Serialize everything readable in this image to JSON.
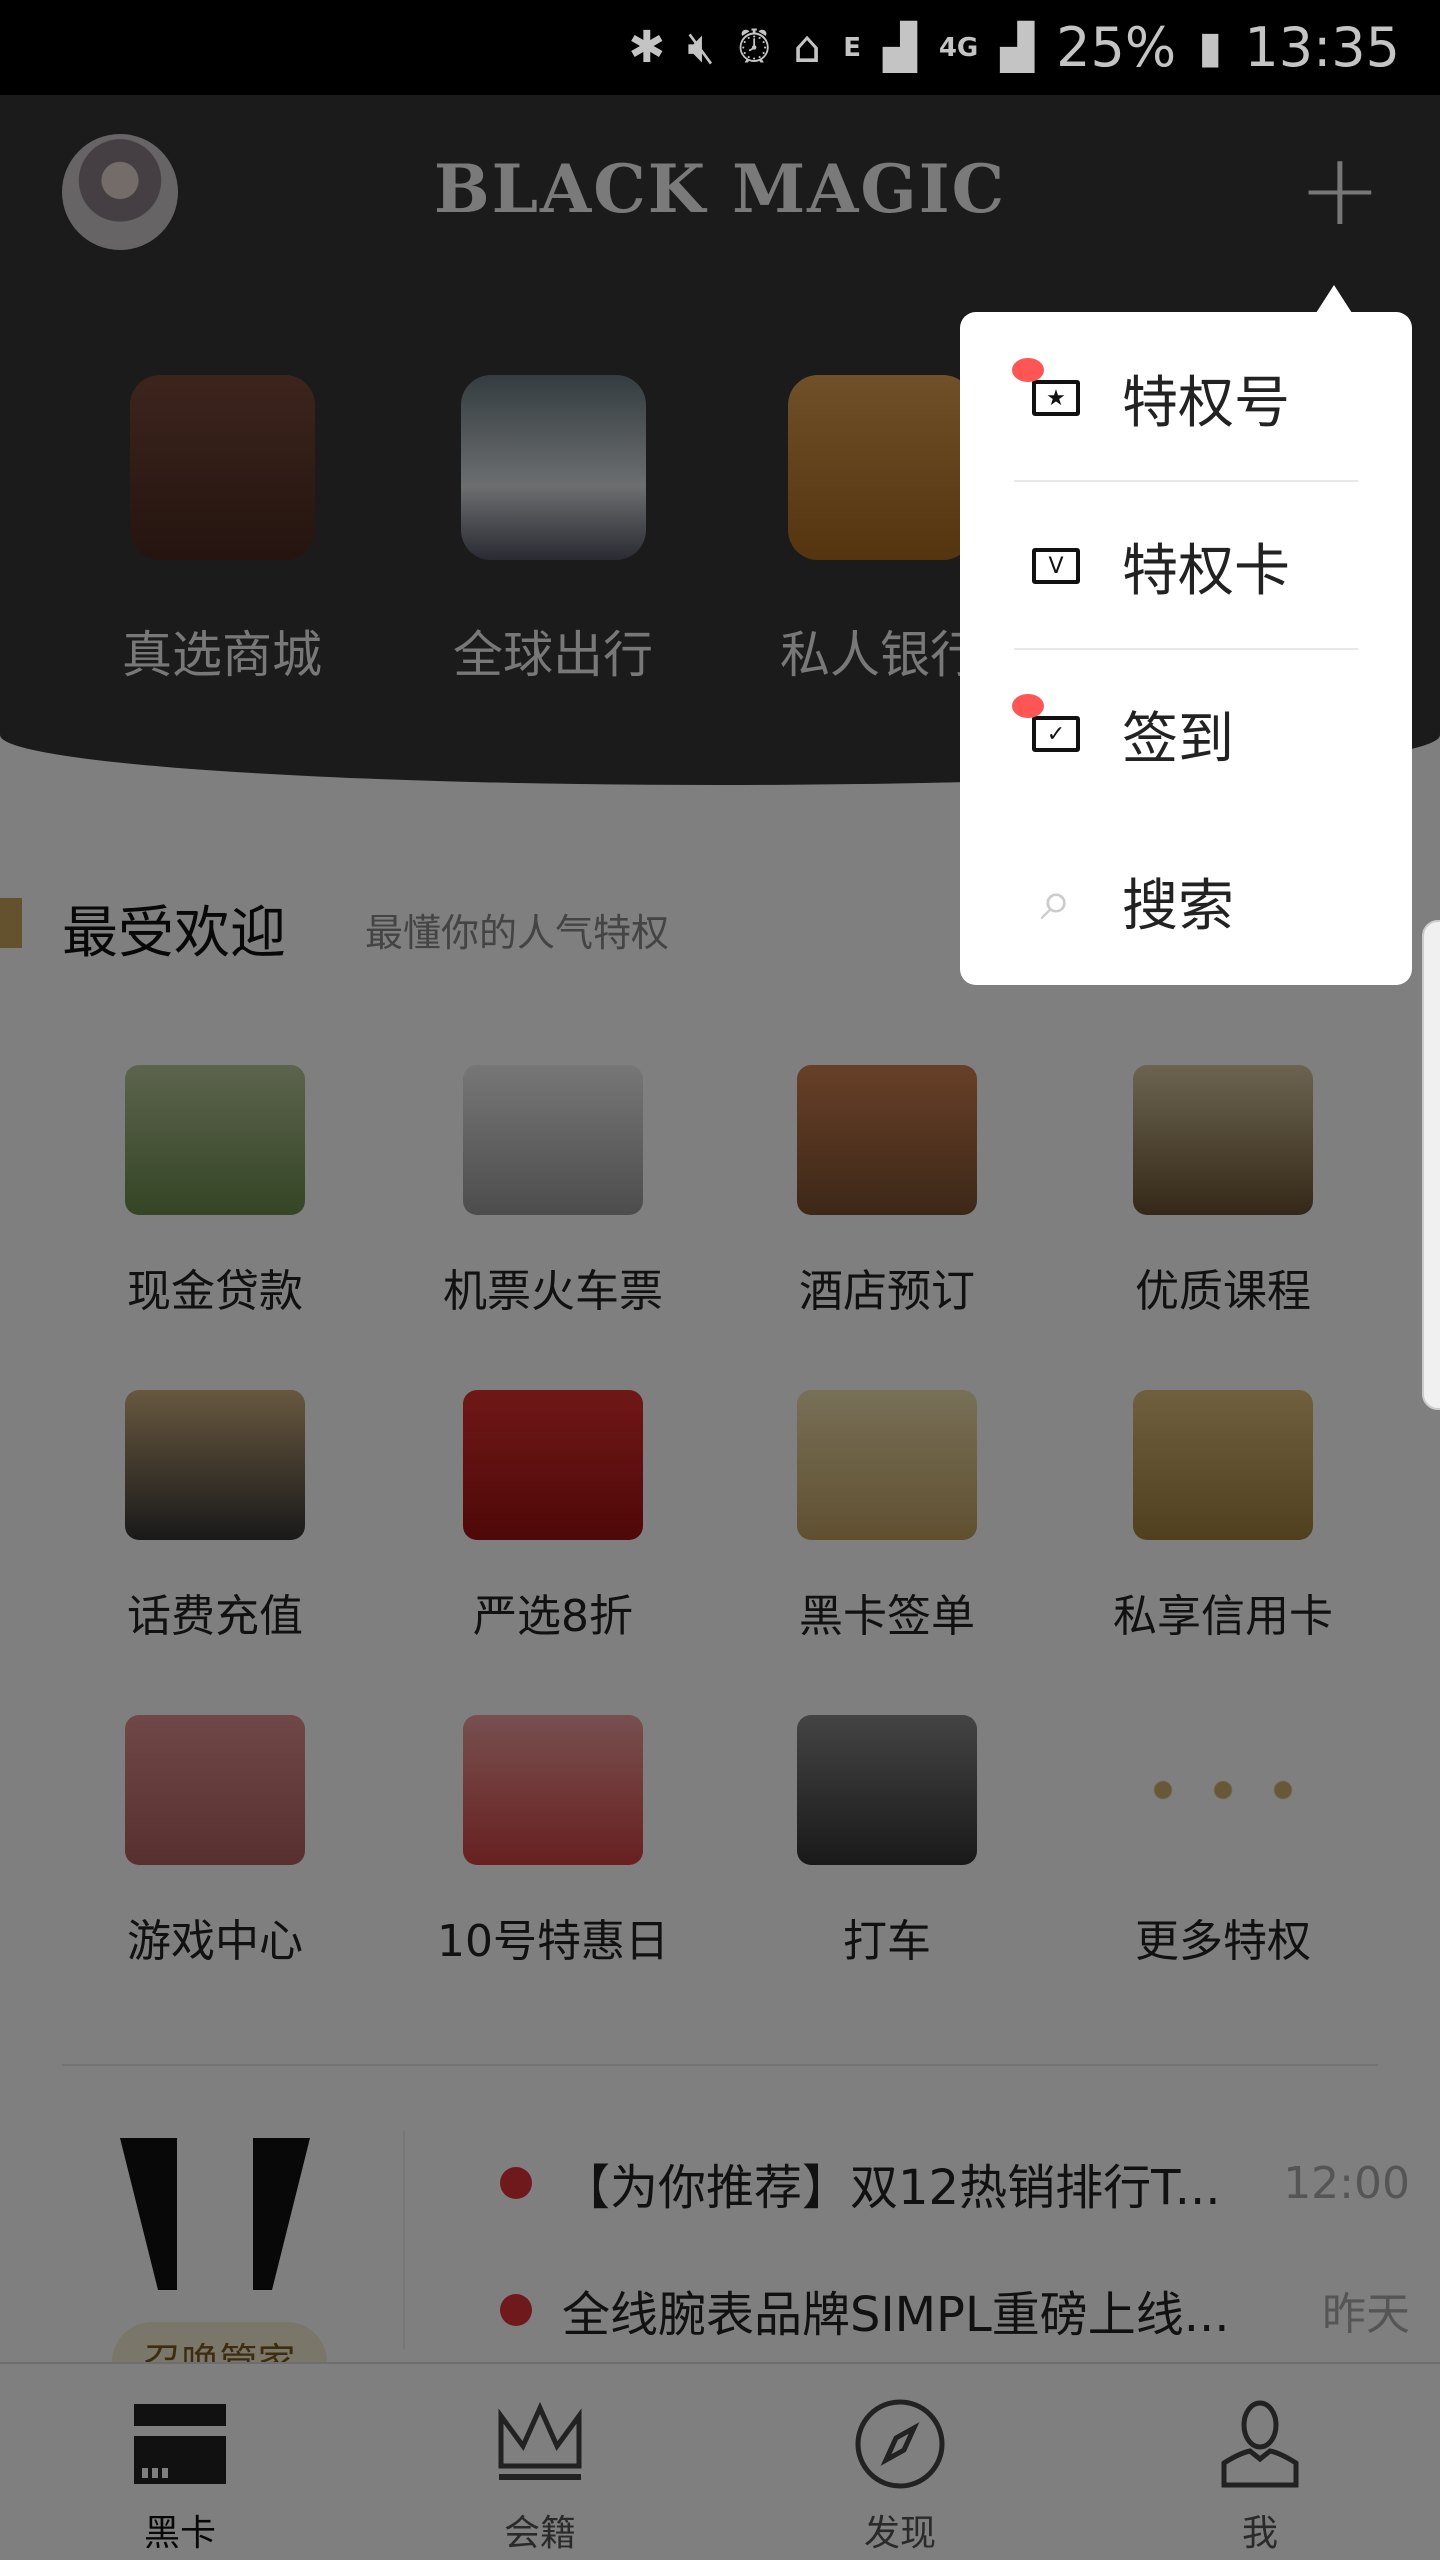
{
  "status_bar": {
    "network_e": "E",
    "network_4g": "4G",
    "battery": "25%",
    "time": "13:35"
  },
  "header": {
    "title": "BLACK MAGIC"
  },
  "top_categories": [
    {
      "label": "真选商城"
    },
    {
      "label": "全球出行"
    },
    {
      "label": "私人银行"
    }
  ],
  "section": {
    "title": "最受欢迎",
    "subtitle": "最懂你的人气特权"
  },
  "grid": [
    {
      "label": "现金贷款"
    },
    {
      "label": "机票火车票"
    },
    {
      "label": "酒店预订"
    },
    {
      "label": "优质课程"
    },
    {
      "label": "话费充值"
    },
    {
      "label": "严选8折"
    },
    {
      "label": "黑卡签单"
    },
    {
      "label": "私享信用卡"
    },
    {
      "label": "游戏中心"
    },
    {
      "label": "10号特惠日"
    },
    {
      "label": "打车"
    },
    {
      "label": "更多特权"
    }
  ],
  "butler": {
    "button": "召唤管家"
  },
  "news": [
    {
      "text": "【为你推荐】双12热销排行T...",
      "time": "12:00"
    },
    {
      "text": "全线腕表品牌SIMPL重磅上线...",
      "time": "昨天"
    }
  ],
  "bottom_nav": [
    {
      "label": "黑卡"
    },
    {
      "label": "会籍"
    },
    {
      "label": "发现"
    },
    {
      "label": "我"
    }
  ],
  "menu": [
    {
      "label": "特权号",
      "badge": true
    },
    {
      "label": "特权卡",
      "badge": false
    },
    {
      "label": "签到",
      "badge": true
    },
    {
      "label": "搜索",
      "badge": false
    }
  ],
  "colors": {
    "accent": "#c9a45c",
    "badge": "#ff5555",
    "news_dot": "#e0333a"
  }
}
